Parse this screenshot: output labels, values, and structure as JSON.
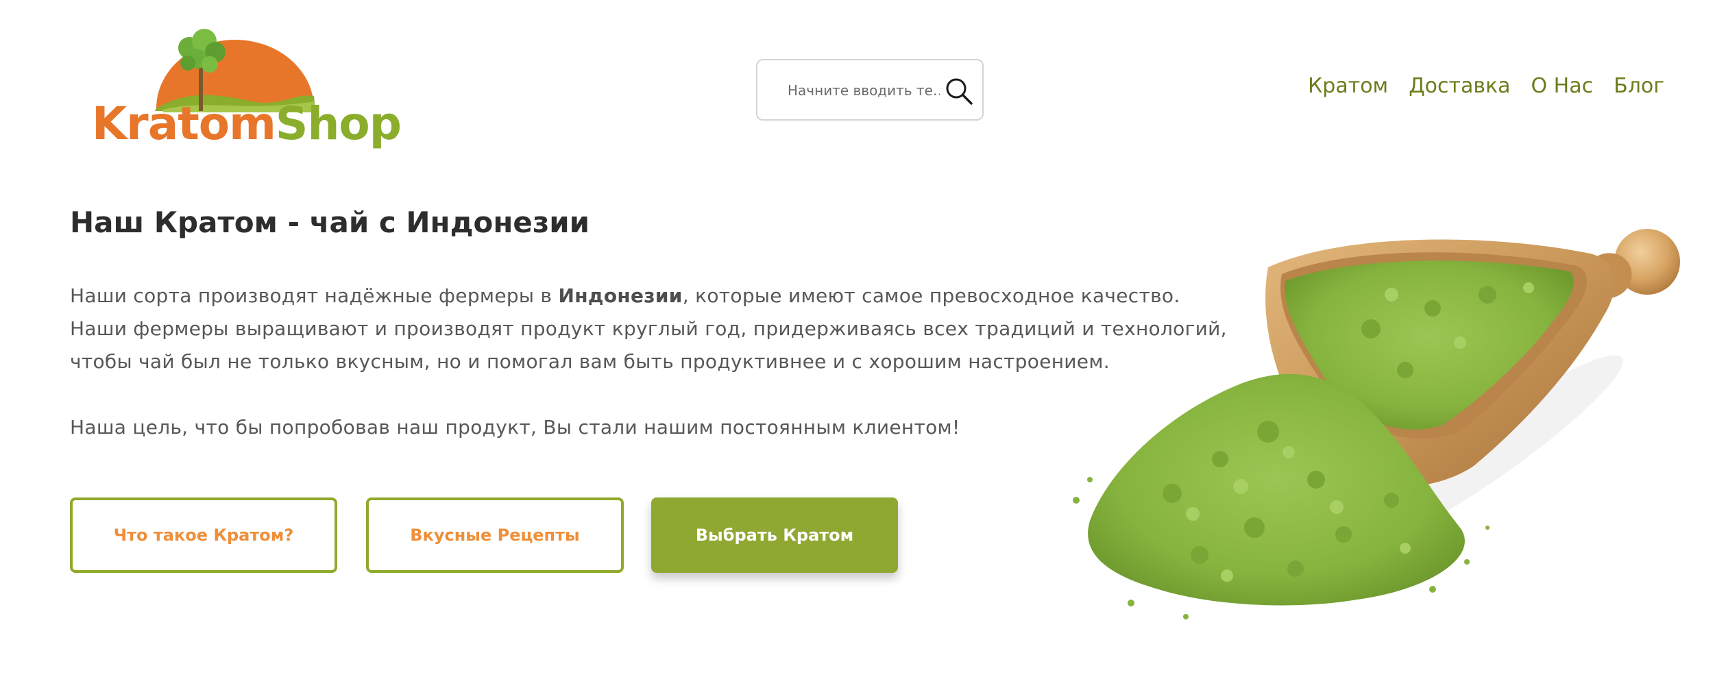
{
  "logo": {
    "word_primary": "Kratom",
    "word_secondary": "Shop",
    "colors": {
      "orange": "#e8762a",
      "green": "#8aad2c",
      "tree": "#6cae3a"
    }
  },
  "search": {
    "placeholder": "Начните вводить те…",
    "icon": "search-icon"
  },
  "nav": {
    "items": [
      {
        "label": "Кратом"
      },
      {
        "label": "Доставка"
      },
      {
        "label": "О Нас"
      },
      {
        "label": "Блог"
      }
    ],
    "color": "#6b7d1d"
  },
  "hero": {
    "title": "Наш Кратом - чай с Индонезии",
    "p1_before": "Наши сорта производят надёжные фермеры в ",
    "p1_bold": "Индонезии",
    "p1_after": ", которые имеют самое превосходное качество.",
    "p2": "Наши фермеры выращивают и производят продукт круглый год, придерживаясь всех традиций и технологий,",
    "p3": "чтобы чай был не только вкусным, но и помогал вам быть продуктивнее и с хорошим настроением.",
    "p4": "Наша цель, что бы попробовав наш продукт, Вы стали нашим постоянным клиентом!"
  },
  "buttons": {
    "what_is": "Что такое Кратом?",
    "recipes": "Вкусные Рецепты",
    "choose": "Выбрать Кратом"
  },
  "colors": {
    "accent_green": "#8fa832",
    "accent_orange": "#ee8f3a",
    "text": "#575757"
  }
}
